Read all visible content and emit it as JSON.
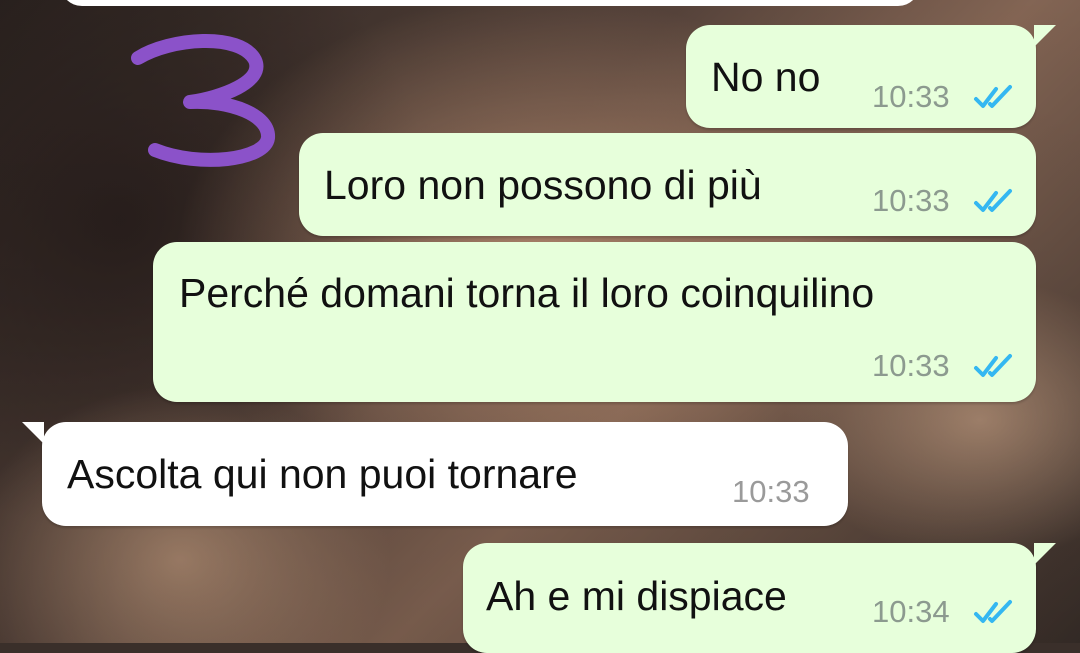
{
  "messages": [
    {
      "direction": "out",
      "text": "No no",
      "time": "10:33",
      "status": "read"
    },
    {
      "direction": "out",
      "text": "Loro non possono di più",
      "time": "10:33",
      "status": "read"
    },
    {
      "direction": "out",
      "text": "Perché domani torna il loro coinquilino",
      "time": "10:33",
      "status": "read"
    },
    {
      "direction": "in",
      "text": "Ascolta qui non puoi tornare",
      "time": "10:33"
    },
    {
      "direction": "out",
      "text": "Ah e mi dispiace",
      "time": "10:34",
      "status": "read"
    }
  ],
  "annotation": {
    "label": "3",
    "color": "#8b52c9"
  },
  "colors": {
    "outgoing_bubble": "#e7ffdb",
    "incoming_bubble": "#ffffff",
    "read_ticks": "#34b7f1"
  },
  "icons": {
    "read_status": "double-check-icon"
  }
}
